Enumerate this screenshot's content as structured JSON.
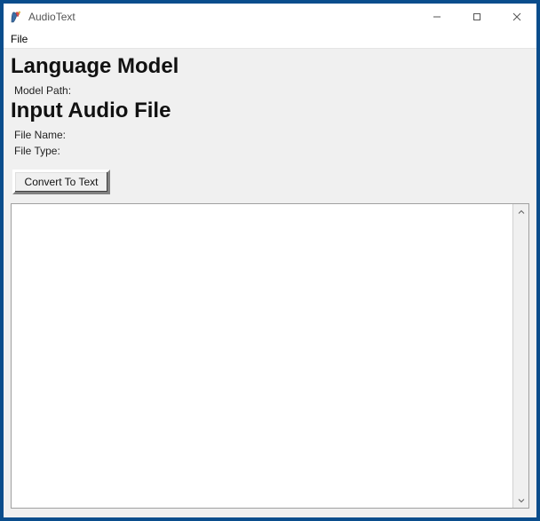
{
  "window": {
    "title": "AudioText"
  },
  "menubar": {
    "file": "File"
  },
  "sections": {
    "language_model_heading": "Language Model",
    "model_path_label": "Model Path:",
    "model_path_value": "",
    "input_audio_heading": "Input Audio File",
    "file_name_label": "File Name:",
    "file_name_value": "",
    "file_type_label": "File Type:",
    "file_type_value": ""
  },
  "buttons": {
    "convert": "Convert To Text"
  },
  "output": {
    "text": ""
  },
  "colors": {
    "frame_border": "#0a4d8c",
    "client_bg": "#f0f0f0"
  }
}
